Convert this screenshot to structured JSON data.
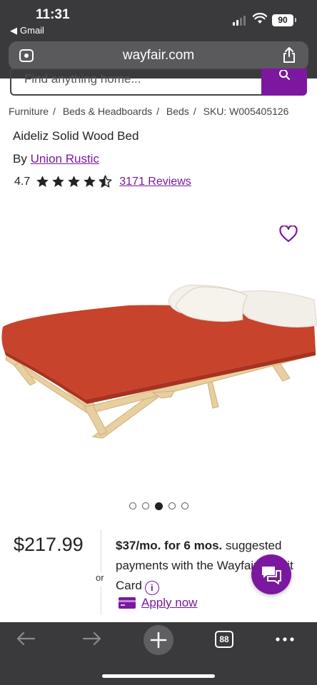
{
  "status_bar": {
    "time": "11:31",
    "back_app": "Gmail",
    "battery": "90"
  },
  "browser": {
    "url": "wayfair.com",
    "tab_count": "88"
  },
  "search": {
    "placeholder": "Find anything home..."
  },
  "breadcrumb": [
    "Furniture",
    "Beds & Headboards",
    "Beds",
    "SKU: W005405126"
  ],
  "product": {
    "title": "Aideliz Solid Wood Bed",
    "by_label": "By",
    "brand": "Union Rustic",
    "rating": "4.7",
    "rating_value": 4.7,
    "reviews": "3171 Reviews",
    "price": "$217.99",
    "image_index": 3,
    "image_count": 5
  },
  "financing": {
    "monthly": "$37/mo. for 6 mos.",
    "text": " suggested payments with the Wayfair Credit Card",
    "or": "or",
    "apply": "Apply now"
  },
  "colors": {
    "brand_purple": "#7b189f",
    "chrome": "#3a3a3c",
    "mattress": "#c7432c"
  },
  "icons": [
    "search-icon",
    "heart-icon",
    "info-icon",
    "credit-card-icon",
    "chat-icon",
    "share-icon",
    "back-arrow-icon",
    "forward-arrow-icon",
    "plus-icon",
    "more-icon"
  ]
}
